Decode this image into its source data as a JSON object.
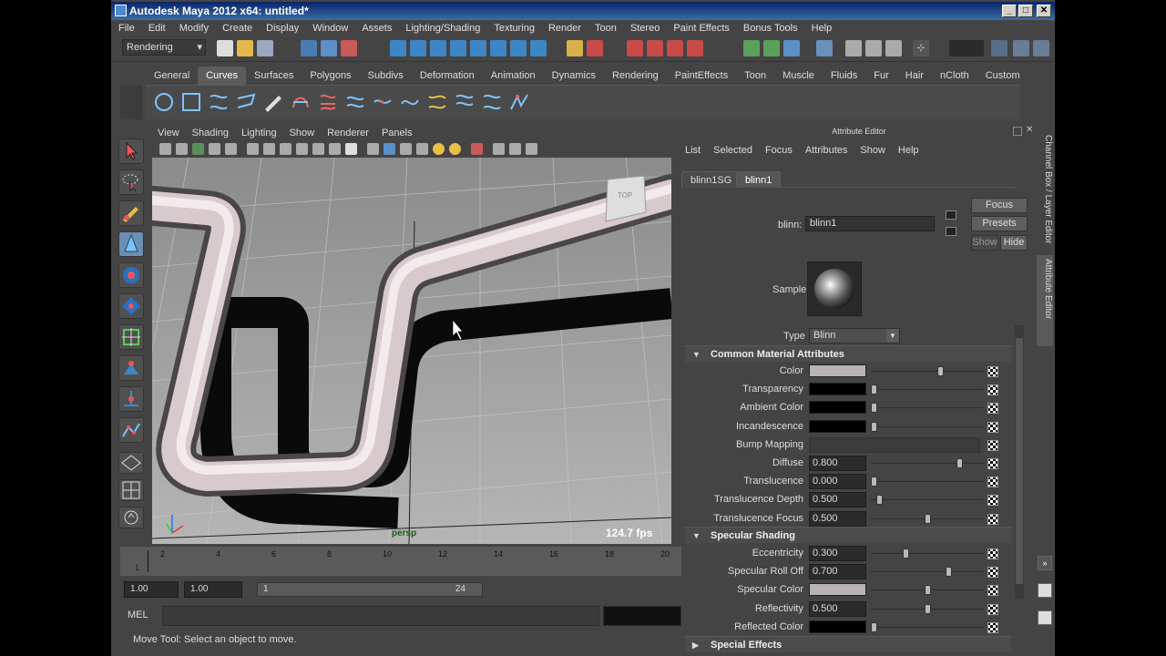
{
  "title": "Autodesk Maya 2012 x64: untitled*",
  "menubar": [
    "File",
    "Edit",
    "Modify",
    "Create",
    "Display",
    "Window",
    "Assets",
    "Lighting/Shading",
    "Texturing",
    "Render",
    "Toon",
    "Stereo",
    "Paint Effects",
    "Bonus Tools",
    "Help"
  ],
  "mode_select": "Rendering",
  "shelf_tabs": [
    "General",
    "Curves",
    "Surfaces",
    "Polygons",
    "Subdivs",
    "Deformation",
    "Animation",
    "Dynamics",
    "Rendering",
    "PaintEffects",
    "Toon",
    "Muscle",
    "Fluids",
    "Fur",
    "Hair",
    "nCloth",
    "Custom"
  ],
  "shelf_active": "Curves",
  "viewport": {
    "menu": [
      "View",
      "Shading",
      "Lighting",
      "Show",
      "Renderer",
      "Panels"
    ],
    "camera_label": "persp",
    "fps": "124.7 fps",
    "cube_label": "TOP"
  },
  "timeslider": {
    "current_frame": "1",
    "ticks": [
      "2",
      "4",
      "6",
      "8",
      "10",
      "12",
      "14",
      "16",
      "18",
      "20"
    ]
  },
  "range": {
    "start": "1.00",
    "playback_start": "1.00",
    "range_start": "1",
    "range_end": "24"
  },
  "command_line": {
    "label": "MEL"
  },
  "help_line": "Move Tool: Select an object to move.",
  "attribute_editor": {
    "title": "Attribute Editor",
    "menu": [
      "List",
      "Selected",
      "Focus",
      "Attributes",
      "Show",
      "Help"
    ],
    "tabs": [
      "blinn1SG",
      "blinn1"
    ],
    "node_label": "blinn:",
    "node_name": "blinn1",
    "buttons": {
      "focus": "Focus",
      "presets": "Presets",
      "show": "Show",
      "hide": "Hide"
    },
    "sample_label": "Sample",
    "type_label": "Type",
    "type_value": "Blinn",
    "sections": {
      "common": "Common Material Attributes",
      "specular": "Specular Shading",
      "special": "Special Effects"
    },
    "common_attrs": [
      {
        "label": "Color",
        "kind": "swatch",
        "swatch": "#b9b3b4",
        "slider": 0.62
      },
      {
        "label": "Transparency",
        "kind": "swatch",
        "swatch": "#000000",
        "slider": 0.0
      },
      {
        "label": "Ambient Color",
        "kind": "swatch",
        "swatch": "#000000",
        "slider": 0.0
      },
      {
        "label": "Incandescence",
        "kind": "swatch",
        "swatch": "#000000",
        "slider": 0.0
      },
      {
        "label": "Bump Mapping",
        "kind": "map"
      },
      {
        "label": "Diffuse",
        "kind": "num",
        "value": "0.800",
        "slider": 0.8
      },
      {
        "label": "Translucence",
        "kind": "num",
        "value": "0.000",
        "slider": 0.0
      },
      {
        "label": "Translucence Depth",
        "kind": "num",
        "value": "0.500",
        "slider": 0.05
      },
      {
        "label": "Translucence Focus",
        "kind": "num",
        "value": "0.500",
        "slider": 0.5
      }
    ],
    "specular_attrs": [
      {
        "label": "Eccentricity",
        "kind": "num",
        "value": "0.300",
        "slider": 0.3
      },
      {
        "label": "Specular Roll Off",
        "kind": "num",
        "value": "0.700",
        "slider": 0.7
      },
      {
        "label": "Specular Color",
        "kind": "swatch",
        "swatch": "#b9b3b4",
        "slider": 0.5
      },
      {
        "label": "Reflectivity",
        "kind": "num",
        "value": "0.500",
        "slider": 0.5
      },
      {
        "label": "Reflected Color",
        "kind": "swatch",
        "swatch": "#000000",
        "slider": 0.0
      }
    ]
  },
  "side_tabs": [
    "Channel Box / Layer Editor",
    "Attribute Editor"
  ],
  "colors": {
    "accent": "#6d8fb3",
    "title_bar": "#0a246a",
    "viewport_bg": "#9a9a9a"
  }
}
